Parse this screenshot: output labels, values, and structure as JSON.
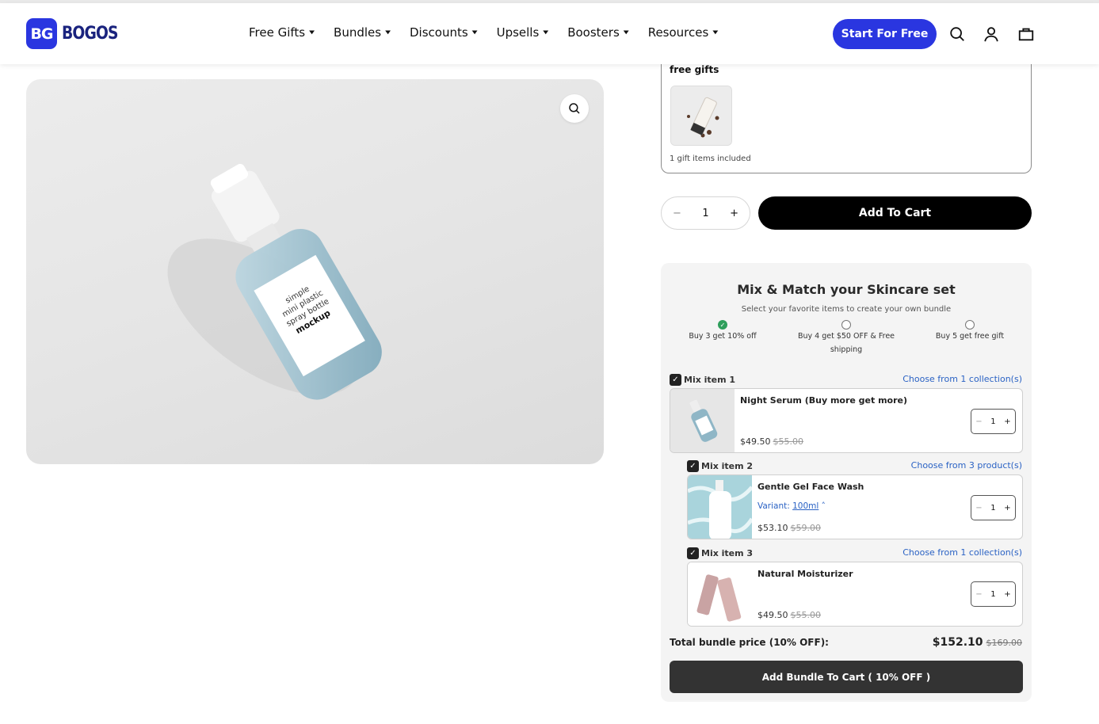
{
  "brand": {
    "name": "BOGOS",
    "mark": "BG"
  },
  "nav": [
    {
      "label": "Free Gifts"
    },
    {
      "label": "Bundles"
    },
    {
      "label": "Discounts"
    },
    {
      "label": "Upsells"
    },
    {
      "label": "Boosters"
    },
    {
      "label": "Resources"
    }
  ],
  "header": {
    "cta_label": "Start For Free"
  },
  "gallery": {
    "bottle_label_lines": [
      "simple",
      "mini plastic",
      "spray bottle",
      "mockup"
    ]
  },
  "gifts": {
    "title": "free gifts",
    "note": "1 gift items included"
  },
  "purchase": {
    "qty": "1",
    "minus": "−",
    "plus": "+",
    "add_to_cart_label": "Add To Cart"
  },
  "bundle": {
    "title": "Mix & Match your Skincare set",
    "subtitle": "Select your favorite items to create your own bundle",
    "tiers": [
      {
        "label": "Buy 3 get 10% off",
        "selected": true
      },
      {
        "label": "Buy 4 get $50 OFF & Free shipping",
        "selected": false
      },
      {
        "label": "Buy 5 get free gift",
        "selected": false
      }
    ],
    "items": [
      {
        "head": "Mix item 1",
        "choose": "Choose from 1 collection(s)",
        "name": "Night Serum (Buy more get more)",
        "price": "$49.50",
        "compare": "$55.00",
        "qty": "1"
      },
      {
        "head": "Mix item 2",
        "choose": "Choose from 3 product(s)",
        "name": "Gentle Gel Face Wash",
        "variant_label": "Variant:",
        "variant_value": "100ml",
        "price": "$53.10",
        "compare": "$59.00",
        "qty": "1"
      },
      {
        "head": "Mix item 3",
        "choose": "Choose from 1 collection(s)",
        "name": "Natural Moisturizer",
        "price": "$49.50",
        "compare": "$55.00",
        "qty": "1"
      }
    ],
    "total_label": "Total bundle price (10% OFF):",
    "total_price": "$152.10",
    "total_compare": "$169.00",
    "button_label": "Add Bundle To Cart ( 10% OFF )"
  },
  "colors": {
    "brand": "#2a36e0",
    "link": "#2a62c4",
    "success": "#2e9e5b"
  },
  "icons": [
    "search-icon",
    "account-icon",
    "cart-icon",
    "zoom-icon",
    "checkbox-checked-icon",
    "chevron-down-icon"
  ]
}
